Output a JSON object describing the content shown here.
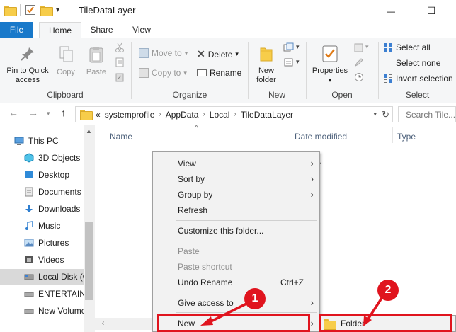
{
  "window": {
    "title": "TileDataLayer",
    "minimize": "—",
    "maximize": "☐",
    "qat_dropdown": "▾"
  },
  "tabs": [
    {
      "label": "File"
    },
    {
      "label": "Home"
    },
    {
      "label": "Share"
    },
    {
      "label": "View"
    }
  ],
  "ribbon": {
    "clipboard": {
      "label": "Clipboard",
      "pin_label": "Pin to Quick access",
      "pin_line1": "Pin to Quick",
      "pin_line2": "access",
      "copy_label": "Copy",
      "paste_label": "Paste"
    },
    "organize": {
      "label": "Organize",
      "move_to": "Move to",
      "copy_to": "Copy to",
      "delete": "Delete",
      "rename": "Rename"
    },
    "new": {
      "label": "New",
      "new_folder_line1": "New",
      "new_folder_line2": "folder"
    },
    "open": {
      "label": "Open",
      "properties": "Properties"
    },
    "select": {
      "label": "Select",
      "select_all": "Select all",
      "select_none": "Select none",
      "invert_selection": "Invert selection"
    }
  },
  "address": {
    "overflow": "«",
    "crumbs": [
      "systemprofile",
      "AppData",
      "Local",
      "TileDataLayer"
    ],
    "search_placeholder": "Search Tile..."
  },
  "nav_pane": {
    "items": [
      {
        "label": "This PC",
        "icon": "computer-icon"
      },
      {
        "label": "3D Objects",
        "icon": "cube-icon"
      },
      {
        "label": "Desktop",
        "icon": "desktop-icon"
      },
      {
        "label": "Documents",
        "icon": "documents-icon"
      },
      {
        "label": "Downloads",
        "icon": "download-arrow-icon"
      },
      {
        "label": "Music",
        "icon": "music-note-icon"
      },
      {
        "label": "Pictures",
        "icon": "pictures-icon"
      },
      {
        "label": "Videos",
        "icon": "film-icon"
      },
      {
        "label": "Local Disk (C",
        "icon": "drive-icon"
      },
      {
        "label": "ENTERTAINM",
        "icon": "drive-icon"
      },
      {
        "label": "New Volume",
        "icon": "drive-icon"
      }
    ]
  },
  "file_list": {
    "columns": [
      "Name",
      "Date modified",
      "Type"
    ],
    "empty_fragment": "y."
  },
  "context_menu": {
    "items": [
      {
        "label": "View",
        "submenu": true
      },
      {
        "label": "Sort by",
        "submenu": true
      },
      {
        "label": "Group by",
        "submenu": true
      },
      {
        "label": "Refresh"
      },
      {
        "label": "Customize this folder..."
      },
      {
        "label": "Paste",
        "disabled": true
      },
      {
        "label": "Paste shortcut",
        "disabled": true
      },
      {
        "label": "Undo Rename",
        "shortcut": "Ctrl+Z"
      },
      {
        "label": "Give access to",
        "submenu": true
      },
      {
        "label": "New",
        "submenu": true
      }
    ],
    "submenu_arrow": "›"
  },
  "submenu": {
    "folder_label": "Folder"
  },
  "annotations": {
    "step1": "1",
    "step2": "2",
    "color": "#e0141e"
  },
  "colors": {
    "file_tab": "#1979ca",
    "folder": "#f7cd4a"
  }
}
